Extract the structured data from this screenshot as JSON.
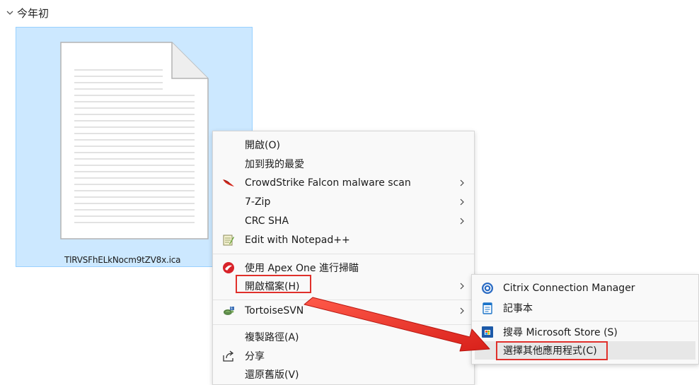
{
  "group": {
    "title": "今年初"
  },
  "file": {
    "name": "TlRVSFhELkNocm9tZV8x.ica",
    "icon": "document-icon"
  },
  "context_menu": {
    "open": "開啟(O)",
    "add_favorite": "加到我的最愛",
    "crowdstrike": "CrowdStrike Falcon malware scan",
    "sevenzip": "7-Zip",
    "crc_sha": "CRC SHA",
    "notepadpp": "Edit with Notepad++",
    "apex_one": "使用 Apex One 進行掃瞄",
    "open_with": "開啟檔案(H)",
    "tortoise": "TortoiseSVN",
    "copy_path": "複製路徑(A)",
    "share": "分享",
    "restore": "還原舊版(V)"
  },
  "open_with_submenu": {
    "citrix": "Citrix Connection Manager",
    "notepad": "記事本",
    "store": "搜尋 Microsoft Store (S)",
    "choose_other": "選擇其他應用程式(C)"
  },
  "colors": {
    "selection": "#cce8ff",
    "selection_border": "#99d1ff",
    "highlight_box": "#e0302b",
    "menu_bg": "#f9f9f9"
  }
}
